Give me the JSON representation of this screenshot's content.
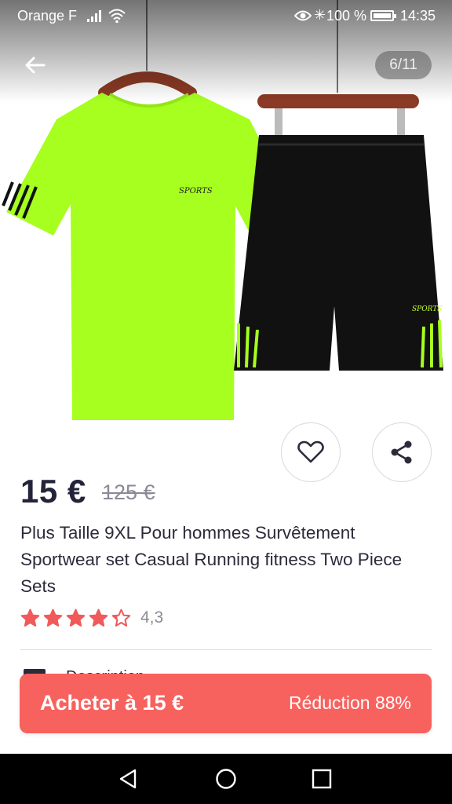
{
  "status_bar": {
    "carrier": "Orange F",
    "battery": "100 %",
    "battery_level": 1.0,
    "time": "14:35"
  },
  "gallery": {
    "counter": "6/11",
    "current": 6,
    "total": 11,
    "print_text": "SPORTS"
  },
  "product": {
    "price": "15 €",
    "old_price": "125 €",
    "title": "Plus Taille 9XL Pour hommes Survêtement Sportwear set Casual Running fitness Two Piece Sets",
    "rating": 4.3,
    "rating_text": "4,3",
    "description_peek": "Description"
  },
  "buy_bar": {
    "label": "Acheter à 15 €",
    "discount": "Réduction 88%"
  },
  "icons": {
    "back": "arrow-left-icon",
    "favorite": "heart-icon",
    "share": "share-icon",
    "star": "star-icon",
    "nav_back": "triangle-back-icon",
    "nav_home": "circle-home-icon",
    "nav_recent": "square-recent-icon"
  },
  "colors": {
    "accent": "#f7625e",
    "star": "#f05a5a",
    "text": "#2b2b3a",
    "shirt": "#a6ff1e",
    "shorts": "#111111",
    "hanger": "#8b3a25"
  }
}
